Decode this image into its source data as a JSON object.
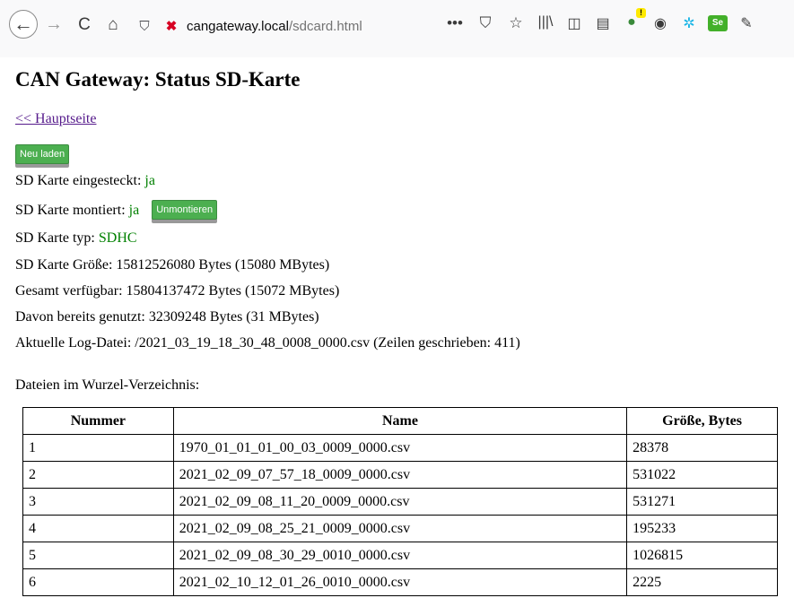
{
  "browser": {
    "url_host": "cangateway.local",
    "url_path": "/sdcard.html",
    "back_icon": "←",
    "forward_icon": "→",
    "reload_icon": "C",
    "home_icon": "⌂",
    "shield_icon": "⛉",
    "insecure_icon": "✖",
    "more_icon": "•••",
    "pocket_icon": "⛉",
    "bookmark_icon": "☆",
    "library_icon": "|||\\",
    "sidebar_icon": "◫",
    "reader_icon": "▤",
    "ext_icon": "●",
    "account_icon": "◉",
    "gear_icon": "✲",
    "se_label": "Se",
    "pencil_icon": "✎"
  },
  "page": {
    "title": "CAN Gateway: Status SD-Karte",
    "back_link": "<< Hauptseite",
    "reload_button": "Neu laden",
    "inserted_label": "SD Karte eingesteckt:",
    "inserted_value": "ja",
    "mounted_label": "SD Karte montiert:",
    "mounted_value": "ja",
    "unmount_button": "Unmontieren",
    "type_label": "SD Karte typ:",
    "type_value": "SDHC",
    "size_line": "SD Karte Größe: 15812526080 Bytes (15080 MBytes)",
    "available_line": "Gesamt verfügbar: 15804137472 Bytes (15072 MBytes)",
    "used_line": "Davon bereits genutzt: 32309248 Bytes (31 MBytes)",
    "logfile_line": "Aktuelle Log-Datei: /2021_03_19_18_30_48_0008_0000.csv (Zeilen geschrieben: 411)",
    "files_heading": "Dateien im Wurzel-Verzeichnis:"
  },
  "table": {
    "headers": [
      "Nummer",
      "Name",
      "Größe, Bytes"
    ],
    "rows": [
      [
        "1",
        "1970_01_01_01_00_03_0009_0000.csv",
        "28378"
      ],
      [
        "2",
        "2021_02_09_07_57_18_0009_0000.csv",
        "531022"
      ],
      [
        "3",
        "2021_02_09_08_11_20_0009_0000.csv",
        "531271"
      ],
      [
        "4",
        "2021_02_09_08_25_21_0009_0000.csv",
        "195233"
      ],
      [
        "5",
        "2021_02_09_08_30_29_0010_0000.csv",
        "1026815"
      ],
      [
        "6",
        "2021_02_10_12_01_26_0010_0000.csv",
        "2225"
      ]
    ]
  },
  "colors": {
    "value_green": "#008000",
    "button_green": "#4caf50",
    "link_visited": "#551a8b"
  }
}
